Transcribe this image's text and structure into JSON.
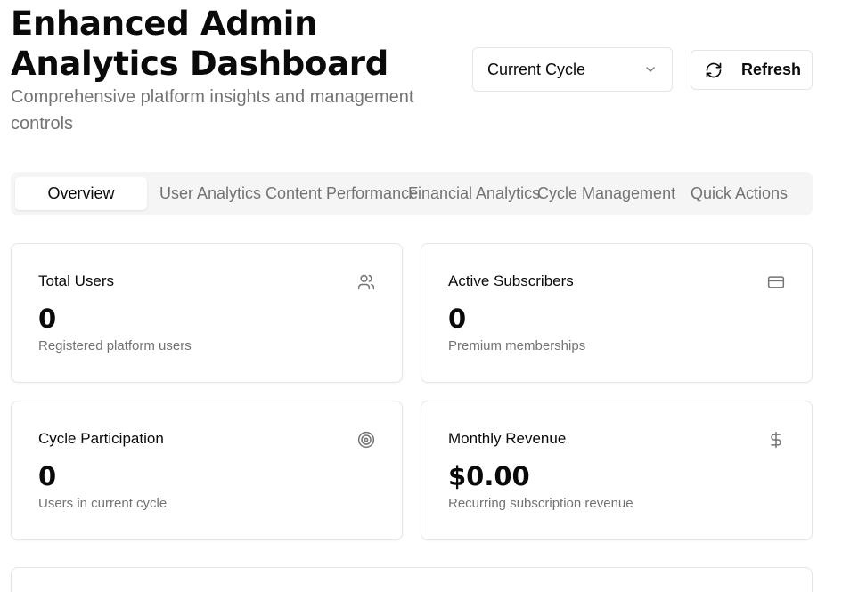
{
  "header": {
    "title": "Enhanced Admin Analytics Dashboard",
    "subtitle": "Comprehensive platform insights and management controls"
  },
  "controls": {
    "cycle_select_value": "Current Cycle",
    "refresh_label": "Refresh"
  },
  "tabs": [
    {
      "label": "Overview",
      "active": true
    },
    {
      "label": "User Analytics",
      "active": false
    },
    {
      "label": "Content Performance",
      "active": false
    },
    {
      "label": "Financial Analytics",
      "active": false
    },
    {
      "label": "Cycle Management",
      "active": false
    },
    {
      "label": "Quick Actions",
      "active": false
    }
  ],
  "cards": [
    {
      "title": "Total Users",
      "value": "0",
      "description": "Registered platform users",
      "icon": "users-icon"
    },
    {
      "title": "Active Subscribers",
      "value": "0",
      "description": "Premium memberships",
      "icon": "credit-card-icon"
    },
    {
      "title": "Cycle Participation",
      "value": "0",
      "description": "Users in current cycle",
      "icon": "target-icon"
    },
    {
      "title": "Monthly Revenue",
      "value": "$0.00",
      "description": "Recurring subscription revenue",
      "icon": "dollar-icon"
    }
  ],
  "colors": {
    "text": "#0a0a0a",
    "muted": "#737373",
    "border": "#e5e5e5",
    "tabs_bg": "#f5f5f5"
  }
}
